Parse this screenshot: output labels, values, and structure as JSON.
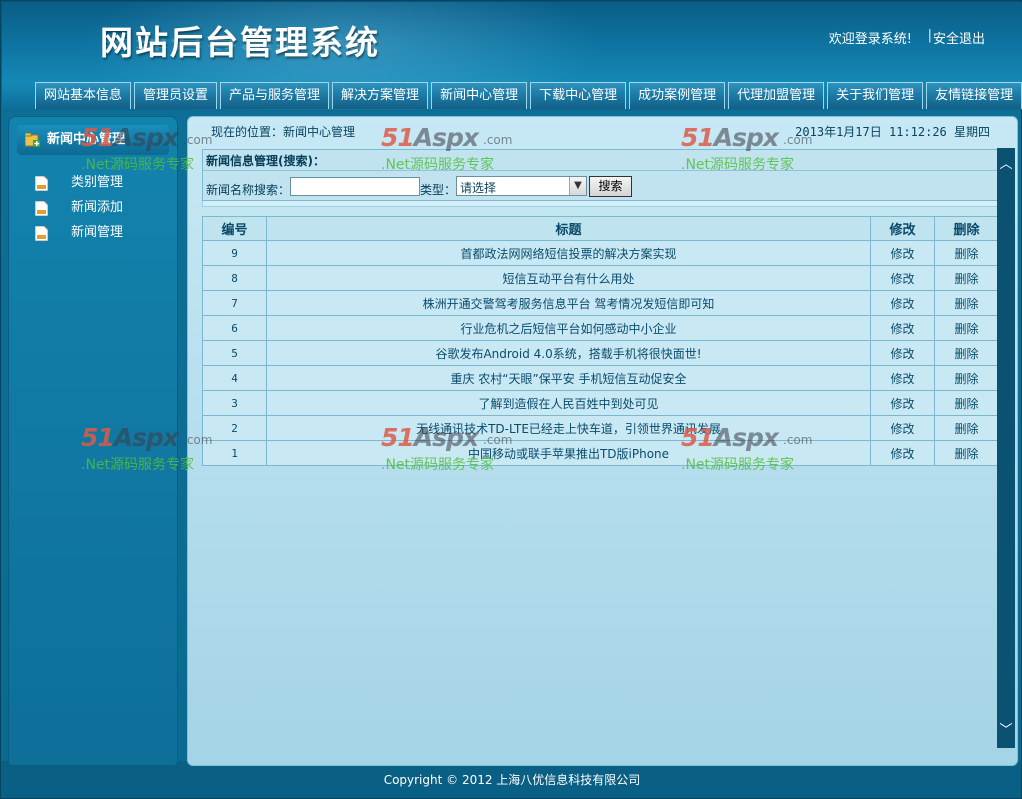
{
  "header": {
    "title": "网站后台管理系统",
    "welcome": "欢迎登录系统!",
    "separator": "|",
    "logout": "安全退出"
  },
  "nav": {
    "tabs": [
      {
        "label": "网站基本信息"
      },
      {
        "label": "管理员设置"
      },
      {
        "label": "产品与服务管理"
      },
      {
        "label": "解决方案管理"
      },
      {
        "label": "新闻中心管理"
      },
      {
        "label": "下载中心管理"
      },
      {
        "label": "成功案例管理"
      },
      {
        "label": "代理加盟管理"
      },
      {
        "label": "关于我们管理"
      },
      {
        "label": "友情链接管理"
      }
    ]
  },
  "sidebar": {
    "heading": "新闻中心管理",
    "items": [
      {
        "label": "类别管理"
      },
      {
        "label": "新闻添加"
      },
      {
        "label": "新闻管理"
      }
    ]
  },
  "main": {
    "location": "现在的位置：新闻中心管理",
    "datetime": "2013年1月17日 11:12:26 星期四",
    "search": {
      "title": "新闻信息管理(搜索)：",
      "name_label": "新闻名称搜索：",
      "name_value": "",
      "type_label": "类型：",
      "type_selected": "请选择",
      "button": "搜索"
    },
    "table": {
      "headers": [
        "编号",
        "标题",
        "修改",
        "删除"
      ],
      "edit_label": "修改",
      "delete_label": "删除",
      "rows": [
        {
          "id": "9",
          "title": "首都政法网网络短信投票的解决方案实现"
        },
        {
          "id": "8",
          "title": "短信互动平台有什么用处"
        },
        {
          "id": "7",
          "title": "株洲开通交警驾考服务信息平台 驾考情况发短信即可知"
        },
        {
          "id": "6",
          "title": "行业危机之后短信平台如何感动中小企业"
        },
        {
          "id": "5",
          "title": "谷歌发布Android 4.0系统，搭载手机将很快面世!"
        },
        {
          "id": "4",
          "title": "重庆 农村“天眼”保平安 手机短信互动促安全"
        },
        {
          "id": "3",
          "title": "了解到造假在人民百姓中到处可见"
        },
        {
          "id": "2",
          "title": "无线通讯技术TD-LTE已经走上快车道，引领世界通讯发展"
        },
        {
          "id": "1",
          "title": "中国移动或联手苹果推出TD版iPhone"
        }
      ]
    }
  },
  "footer": {
    "copyright": "Copyright © 2012 上海八优信息科技有限公司"
  },
  "watermark": {
    "brand_num": "51",
    "brand_word": "Aspx",
    "domain": ".com",
    "tagline": ".Net源码服务专家"
  }
}
